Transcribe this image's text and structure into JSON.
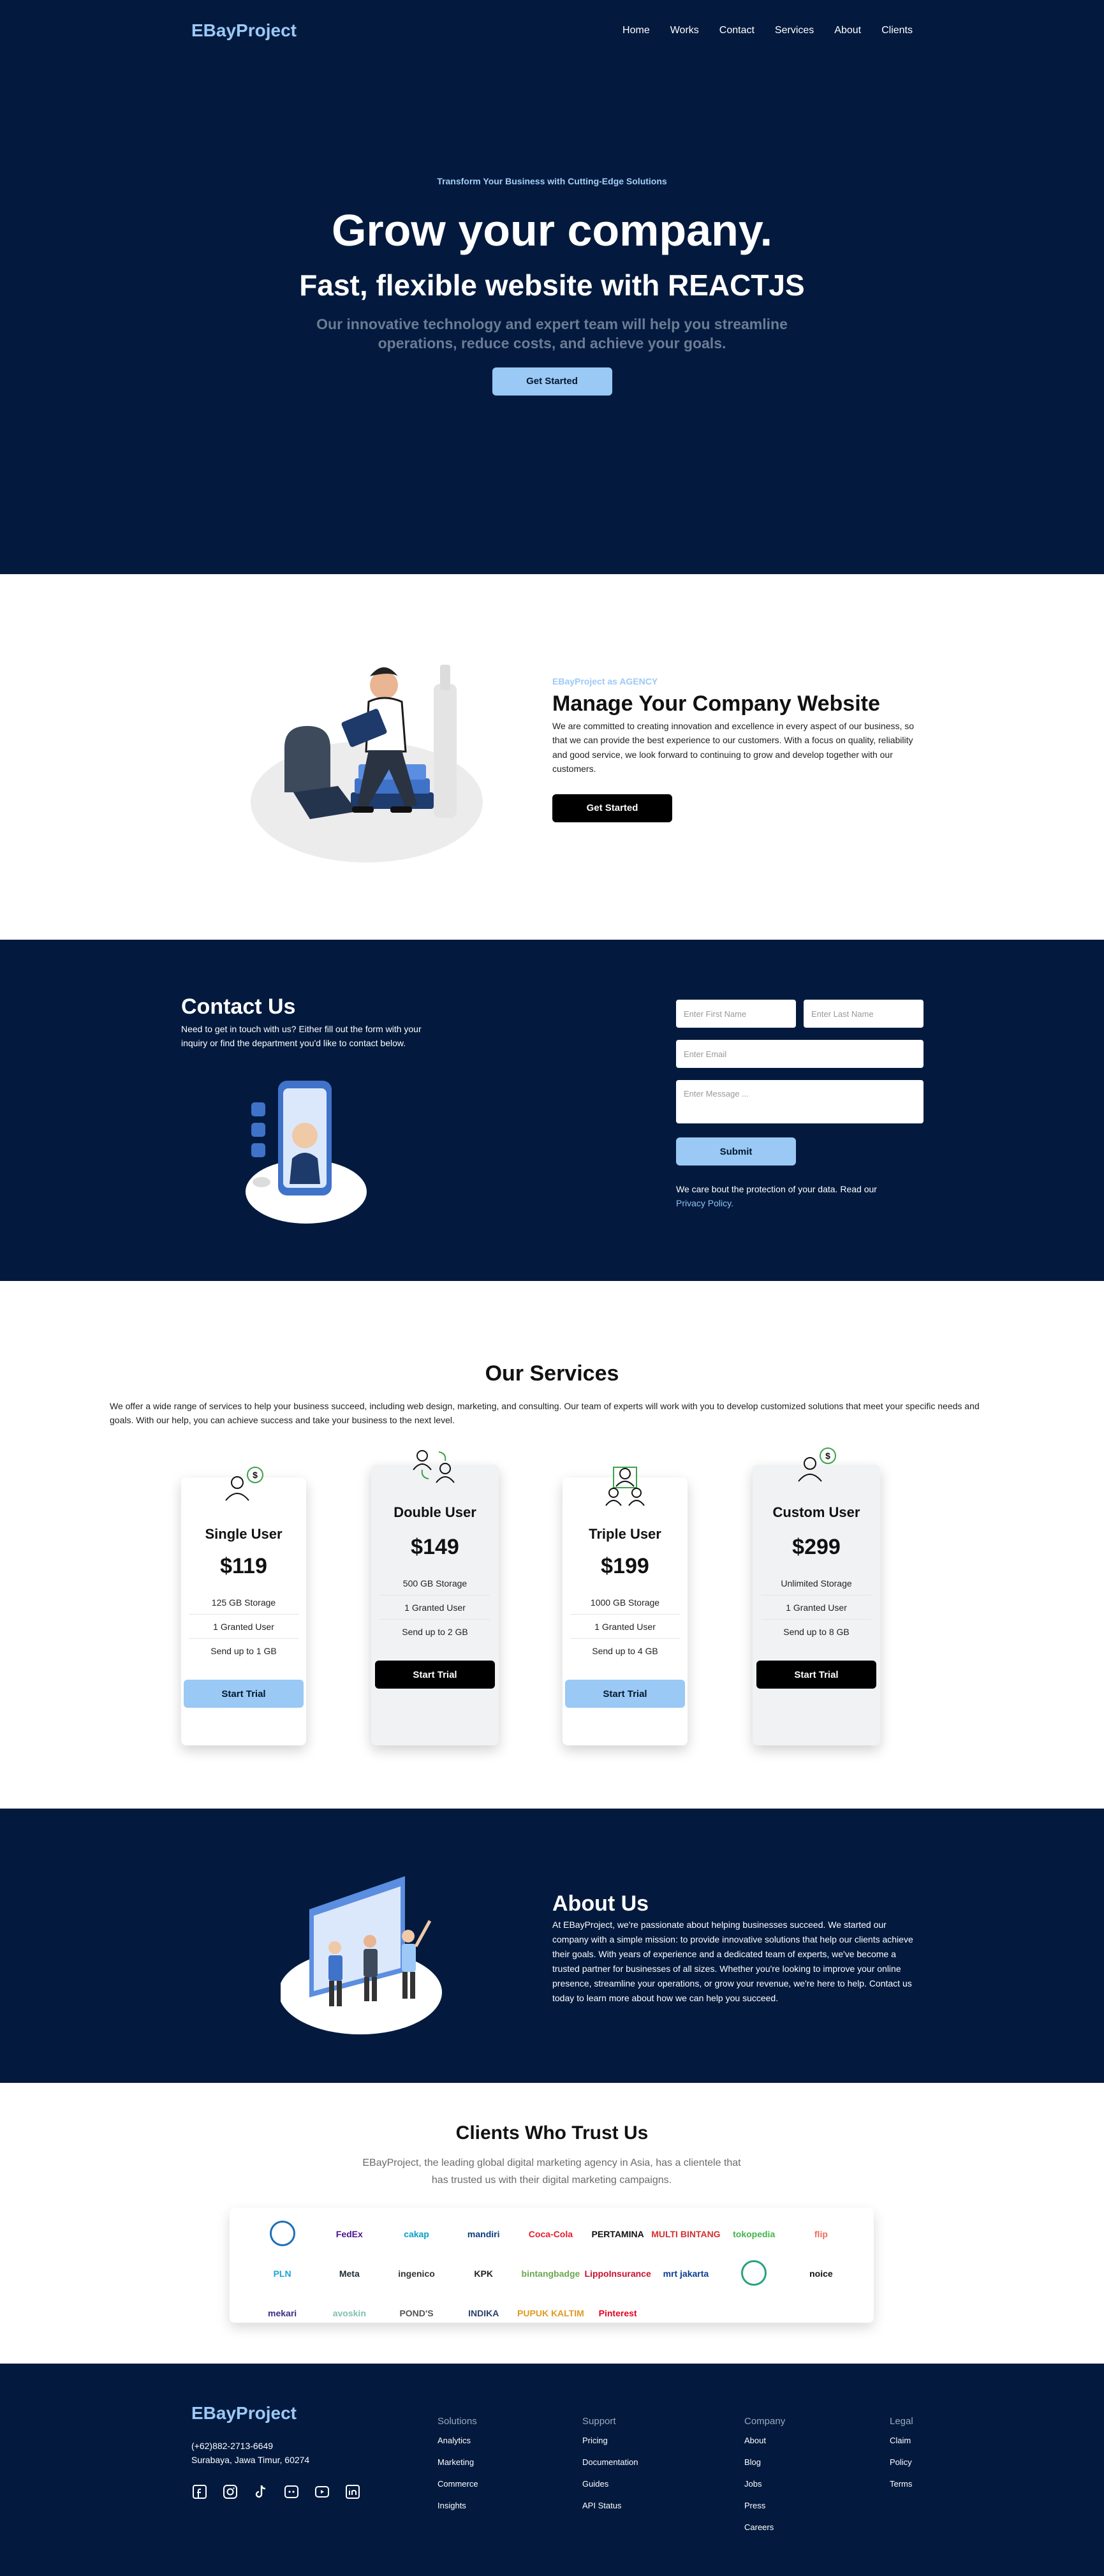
{
  "nav": {
    "brand": "EBayProject",
    "links": [
      "Home",
      "Works",
      "Contact",
      "Services",
      "About",
      "Clients"
    ]
  },
  "hero": {
    "eyebrow": "Transform Your Business with Cutting-Edge Solutions",
    "title": "Grow your company.",
    "subtitle": "Fast, flexible website with REACTJS",
    "description": "Our innovative technology and expert team will help you streamline operations, reduce costs, and achieve your goals.",
    "cta": "Get Started"
  },
  "agency": {
    "label": "EBayProject as AGENCY",
    "title": "Manage Your Company Website",
    "description": "We are committed to creating innovation and excellence in every aspect of our business, so that we can provide the best experience to our customers. With a focus on quality, reliability and good service, we look forward to continuing to grow and develop together with our customers.",
    "cta": "Get Started"
  },
  "contact": {
    "title": "Contact Us",
    "description": "Need to get in touch with us? Either fill out the form with your inquiry or find the department you'd like to contact below.",
    "first_name_placeholder": "Enter First Name",
    "last_name_placeholder": "Enter Last Name",
    "email_placeholder": "Enter Email",
    "message_placeholder": "Enter Message ...",
    "submit": "Submit",
    "privacy_text": "We care bout the protection of your data. Read our",
    "privacy_link": "Privacy Policy."
  },
  "services": {
    "title": "Our Services",
    "description": "We offer a wide range of services to help your business succeed, including web design, marketing, and consulting. Our team of experts will work with you to develop customized solutions that meet your specific needs and goals. With our help, you can achieve success and take your business to the next level.",
    "plans": [
      {
        "name": "Single User",
        "price": "$119",
        "features": [
          "125 GB Storage",
          "1 Granted User",
          "Send up to 1 GB"
        ],
        "cta": "Start Trial",
        "icon": "single-user-icon"
      },
      {
        "name": "Double User",
        "price": "$149",
        "features": [
          "500 GB Storage",
          "1 Granted User",
          "Send up to 2 GB"
        ],
        "cta": "Start Trial",
        "icon": "double-user-icon"
      },
      {
        "name": "Triple User",
        "price": "$199",
        "features": [
          "1000 GB Storage",
          "1 Granted User",
          "Send up to 4 GB"
        ],
        "cta": "Start Trial",
        "icon": "triple-user-icon"
      },
      {
        "name": "Custom User",
        "price": "$299",
        "features": [
          "Unlimited Storage",
          "1 Granted User",
          "Send up to 8 GB"
        ],
        "cta": "Start Trial",
        "icon": "custom-user-icon"
      }
    ]
  },
  "about": {
    "title": "About Us",
    "description": "At EBayProject, we're passionate about helping businesses succeed. We started our company with a simple mission: to provide innovative solutions that help our clients achieve their goals. With years of experience and a dedicated team of experts, we've become a trusted partner for businesses of all sizes. Whether you're looking to improve your online presence, streamline your operations, or grow your revenue, we're here to help. Contact us today to learn more about how we can help you succeed."
  },
  "clients": {
    "title": "Clients Who Trust Us",
    "description": "EBayProject, the leading global digital marketing agency in Asia, has a clientele that has trusted us with their digital marketing campaigns.",
    "logos": [
      {
        "name": "",
        "color": "#1d6fb8",
        "icon": "circle-badge"
      },
      {
        "name": "FedEx",
        "color": "#4d148c"
      },
      {
        "name": "cakap",
        "color": "#0aa0c8"
      },
      {
        "name": "mandiri",
        "color": "#0b3c7d"
      },
      {
        "name": "Coca-Cola",
        "color": "#e41e2b"
      },
      {
        "name": "PERTAMINA",
        "color": "#111111"
      },
      {
        "name": "MULTI BINTANG",
        "color": "#d3312f"
      },
      {
        "name": "tokopedia",
        "color": "#42b549"
      },
      {
        "name": "flip",
        "color": "#f26a5c"
      },
      {
        "name": "PLN",
        "color": "#1ea4dc"
      },
      {
        "name": "Meta",
        "color": "#1c2b33"
      },
      {
        "name": "ingenico",
        "color": "#333333"
      },
      {
        "name": "KPK",
        "color": "#222222"
      },
      {
        "name": "bintangbadge",
        "color": "#6aa84f"
      },
      {
        "name": "LippoInsurance",
        "color": "#c8102e"
      },
      {
        "name": "mrt jakarta",
        "color": "#0b3d91"
      },
      {
        "name": "",
        "color": "#28a37f",
        "icon": "circle-badge"
      },
      {
        "name": "noice",
        "color": "#111111"
      },
      {
        "name": "mekari",
        "color": "#3b2e83"
      },
      {
        "name": "avoskin",
        "color": "#7fbfb0"
      },
      {
        "name": "POND'S",
        "color": "#555555"
      },
      {
        "name": "INDIKA",
        "color": "#2a3f6b"
      },
      {
        "name": "PUPUK KALTIM",
        "color": "#e09a22"
      },
      {
        "name": "Pinterest",
        "color": "#e60023"
      }
    ]
  },
  "footer": {
    "brand": "EBayProject",
    "phone": "(+62)882-2713-6649",
    "address": "Surabaya, Jawa Timur, 60274",
    "columns": [
      {
        "title": "Solutions",
        "links": [
          "Analytics",
          "Marketing",
          "Commerce",
          "Insights"
        ]
      },
      {
        "title": "Support",
        "links": [
          "Pricing",
          "Documentation",
          "Guides",
          "API Status"
        ]
      },
      {
        "title": "Company",
        "links": [
          "About",
          "Blog",
          "Jobs",
          "Press",
          "Careers"
        ]
      },
      {
        "title": "Legal",
        "links": [
          "Claim",
          "Policy",
          "Terms"
        ]
      }
    ],
    "social_icons": [
      "facebook-icon",
      "instagram-icon",
      "tiktok-icon",
      "discord-icon",
      "youtube-icon",
      "linkedin-icon"
    ]
  }
}
